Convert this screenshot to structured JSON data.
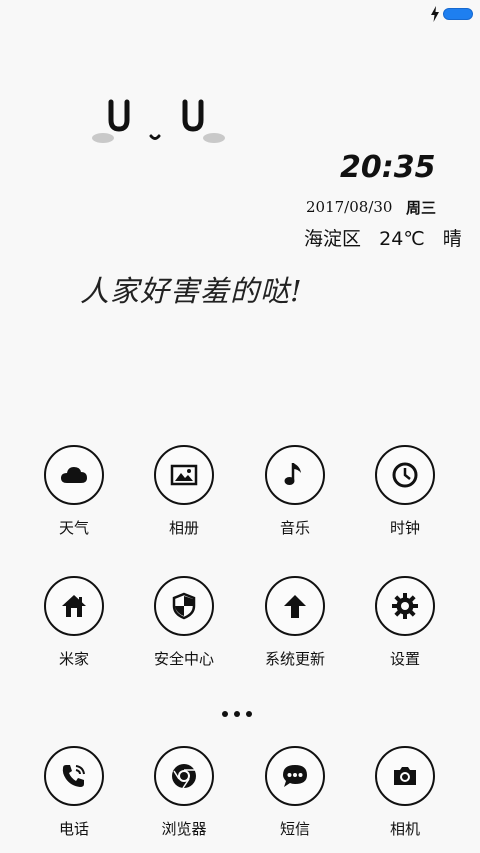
{
  "status": {
    "charging_icon": "bolt-icon",
    "battery_icon": "battery-icon",
    "battery_color": "#1e7ff0"
  },
  "widget": {
    "time": "20:35",
    "date": "2017/08/30",
    "weekday": "周三",
    "district": "海淀区",
    "temperature": "24℃",
    "condition": "晴",
    "tagline": "人家好害羞的哒!"
  },
  "apps": [
    {
      "label": "天气",
      "icon": "cloud-icon"
    },
    {
      "label": "相册",
      "icon": "photo-icon"
    },
    {
      "label": "音乐",
      "icon": "music-note-icon"
    },
    {
      "label": "时钟",
      "icon": "clock-icon"
    },
    {
      "label": "米家",
      "icon": "home-icon"
    },
    {
      "label": "安全中心",
      "icon": "shield-icon"
    },
    {
      "label": "系统更新",
      "icon": "arrow-up-icon"
    },
    {
      "label": "设置",
      "icon": "gear-icon"
    }
  ],
  "dock": [
    {
      "label": "电话",
      "icon": "phone-icon"
    },
    {
      "label": "浏览器",
      "icon": "browser-icon"
    },
    {
      "label": "短信",
      "icon": "message-icon"
    },
    {
      "label": "相机",
      "icon": "camera-icon"
    }
  ]
}
